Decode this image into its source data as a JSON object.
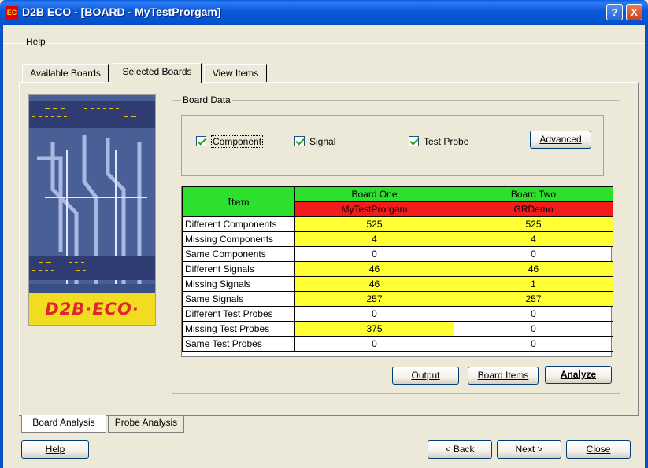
{
  "window": {
    "app_icon_label": "EC",
    "title": "D2B ECO - [BOARD - MyTestProrgam]",
    "help_button": "?",
    "close_button": "X"
  },
  "menu": {
    "help": "Help"
  },
  "tabs_top": [
    "Available Boards",
    "Selected Boards",
    "View Items"
  ],
  "logo": {
    "text": "D2B·ECO·"
  },
  "board_data": {
    "group_label": "Board Data",
    "checkboxes": [
      {
        "label": "Component",
        "checked": true
      },
      {
        "label": "Signal",
        "checked": true
      },
      {
        "label": "Test Probe",
        "checked": true
      }
    ],
    "advanced_button": "Advanced"
  },
  "table": {
    "item_header": "Item",
    "columns": [
      {
        "header": "Board One",
        "board": "MyTestProrgam"
      },
      {
        "header": "Board Two",
        "board": "GRDemo"
      }
    ],
    "rows": [
      {
        "item": "Different Components",
        "one": "525",
        "two": "525",
        "highlight": true
      },
      {
        "item": "Missing Components",
        "one": "4",
        "two": "4",
        "highlight": true
      },
      {
        "item": "Same Components",
        "one": "0",
        "two": "0",
        "highlight": false
      },
      {
        "item": "Different Signals",
        "one": "46",
        "two": "46",
        "highlight": true
      },
      {
        "item": "Missing Signals",
        "one": "46",
        "two": "1",
        "highlight": true
      },
      {
        "item": "Same Signals",
        "one": "257",
        "two": "257",
        "highlight": true
      },
      {
        "item": "Different Test Probes",
        "one": "0",
        "two": "0",
        "highlight": false
      },
      {
        "item": "Missing Test Probes",
        "one": "375",
        "two": "0",
        "highlight": "one"
      },
      {
        "item": "Same Test Probes",
        "one": "0",
        "two": "0",
        "highlight": false
      }
    ]
  },
  "action_buttons": {
    "output": "Output",
    "board_items": "Board Items",
    "analyze": "Analyze"
  },
  "tabs_bottom": [
    "Board Analysis",
    "Probe Analysis"
  ],
  "footer": {
    "help": "Help",
    "back": "< Back",
    "next": "Next >",
    "close": "Close"
  },
  "colors": {
    "green": "#2ee02e",
    "red": "#f31b1b",
    "yellow": "#ffff33",
    "title_blue": "#0553d0"
  }
}
